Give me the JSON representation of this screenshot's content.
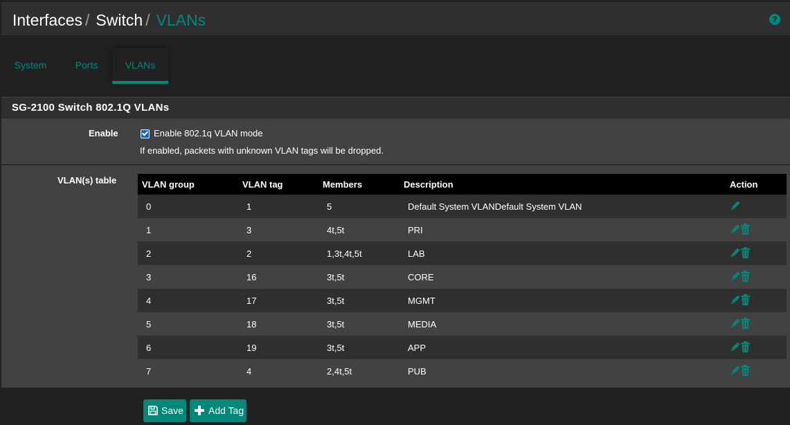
{
  "header": {
    "breadcrumb": [
      "Interfaces",
      "Switch",
      "VLANs"
    ],
    "separator": "/",
    "help_icon": "question-circle-icon"
  },
  "tabs": [
    {
      "label": "System",
      "active": false
    },
    {
      "label": "Ports",
      "active": false
    },
    {
      "label": "VLANs",
      "active": true
    }
  ],
  "panel": {
    "title": "SG-2100 Switch 802.1Q VLANs",
    "enable": {
      "label": "Enable",
      "checkbox_label": "Enable 802.1q VLAN mode",
      "checked": true,
      "help": "If enabled, packets with unknown VLAN tags will be dropped."
    },
    "table_label": "VLAN(s) table",
    "columns": [
      "VLAN group",
      "VLAN tag",
      "Members",
      "Description",
      "Action"
    ],
    "rows": [
      {
        "group": "0",
        "tag": "1",
        "members": "5",
        "description": "Default System VLANDefault System VLAN",
        "actions": [
          "edit"
        ]
      },
      {
        "group": "1",
        "tag": "3",
        "members": "4t,5t",
        "description": "PRI",
        "actions": [
          "edit",
          "delete"
        ]
      },
      {
        "group": "2",
        "tag": "2",
        "members": "1,3t,4t,5t",
        "description": "LAB",
        "actions": [
          "edit",
          "delete"
        ]
      },
      {
        "group": "3",
        "tag": "16",
        "members": "3t,5t",
        "description": "CORE",
        "actions": [
          "edit",
          "delete"
        ]
      },
      {
        "group": "4",
        "tag": "17",
        "members": "3t,5t",
        "description": "MGMT",
        "actions": [
          "edit",
          "delete"
        ]
      },
      {
        "group": "5",
        "tag": "18",
        "members": "3t,5t",
        "description": "MEDIA",
        "actions": [
          "edit",
          "delete"
        ]
      },
      {
        "group": "6",
        "tag": "19",
        "members": "3t,5t",
        "description": "APP",
        "actions": [
          "edit",
          "delete"
        ]
      },
      {
        "group": "7",
        "tag": "4",
        "members": "2,4t,5t",
        "description": "PUB",
        "actions": [
          "edit",
          "delete"
        ]
      }
    ]
  },
  "buttons": {
    "save": {
      "label": "Save",
      "icon": "save-icon"
    },
    "add_tag": {
      "label": "Add Tag",
      "icon": "plus-icon"
    }
  },
  "colors": {
    "accent": "#00897b",
    "page_bg": "#212121",
    "panel_bg": "#424242",
    "header_bg": "#2f2f2f",
    "table_head_bg": "#000000"
  }
}
